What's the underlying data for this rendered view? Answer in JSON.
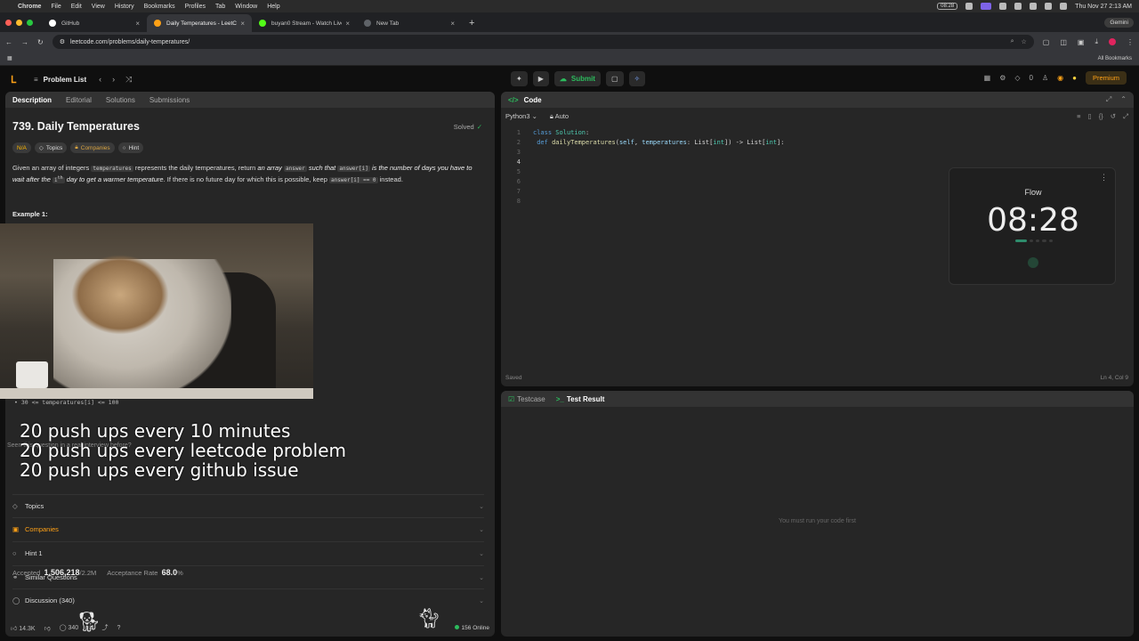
{
  "menubar": {
    "items": [
      "Chrome",
      "File",
      "Edit",
      "View",
      "History",
      "Bookmarks",
      "Profiles",
      "Tab",
      "Window",
      "Help"
    ],
    "timer_badge": "08:28",
    "datetime": "Thu Nov 27  2:13 AM"
  },
  "tabs": [
    {
      "title": "GitHub",
      "fav_color": "#ffffff"
    },
    {
      "title": "Daily Temperatures - LeetCo",
      "fav_color": "#ffa116"
    },
    {
      "title": "buyan0 Stream - Watch Live",
      "fav_color": "#53fc18"
    },
    {
      "title": "New Tab",
      "fav_color": "#5f6368"
    }
  ],
  "browser": {
    "url": "leetcode.com/problems/daily-temperatures/",
    "gemini": "Gemini",
    "all_bookmarks": "All Bookmarks"
  },
  "lc_header": {
    "problem_list": "Problem List",
    "submit": "Submit",
    "streak": "0",
    "premium": "Premium"
  },
  "left": {
    "tabs": [
      "Description",
      "Editorial",
      "Solutions",
      "Submissions"
    ],
    "title": "739. Daily Temperatures",
    "solved": "Solved",
    "tags": [
      "N/A",
      "Topics",
      "Companies",
      "Hint"
    ],
    "desc_1": "Given an array of integers",
    "code_temperatures": "temperatures",
    "desc_2": "represents the daily temperatures, return",
    "desc_3": "an array",
    "code_answer": "answer",
    "desc_4": "such that",
    "code_answer_i": "answer[i]",
    "desc_5": "is the number of days you have to wait after the",
    "code_ith": "i",
    "desc_ith_sup": "th",
    "desc_6": "day to get a warmer temperature",
    "desc_7": ". If there is no future day for which this is possible, keep",
    "code_answer_zero": "answer[i] == 0",
    "desc_8": "instead.",
    "example": "Example 1:",
    "constraint": "30 <= temperatures[i] <= 100",
    "overlay_lines": [
      "20 push ups every 10 minutes",
      "20 push ups every leetcode problem",
      "20 push ups every github issue"
    ],
    "behind_text": "Seen this question in a real interview before?",
    "accepted_label": "Accepted",
    "accepted_value": "1,506,218",
    "accepted_total": "/2.2M",
    "acceptance_label": "Acceptance Rate",
    "acceptance_value": "68.0",
    "acceptance_pct": "%",
    "sections": [
      "Topics",
      "Companies",
      "Hint 1",
      "Similar Questions",
      "Discussion (340)"
    ],
    "likes": "14.3K",
    "comments": "340",
    "online": "156 Online"
  },
  "code": {
    "tab": "Code",
    "language": "Python3",
    "auto": "Auto",
    "lines": [
      "class Solution:",
      "    def dailyTemperatures(self, temperatures: List[int]) -> List[int]:",
      "",
      "",
      "",
      "",
      "",
      ""
    ],
    "saved": "Saved",
    "cursor": "Ln 4, Col 9"
  },
  "flow": {
    "title": "Flow",
    "time": "08:28"
  },
  "test": {
    "tabs": [
      "Testcase",
      "Test Result"
    ],
    "message": "You must run your code first"
  },
  "colors": {
    "accent": "#ffa116",
    "success": "#2cbb5d",
    "panel": "#262626"
  }
}
